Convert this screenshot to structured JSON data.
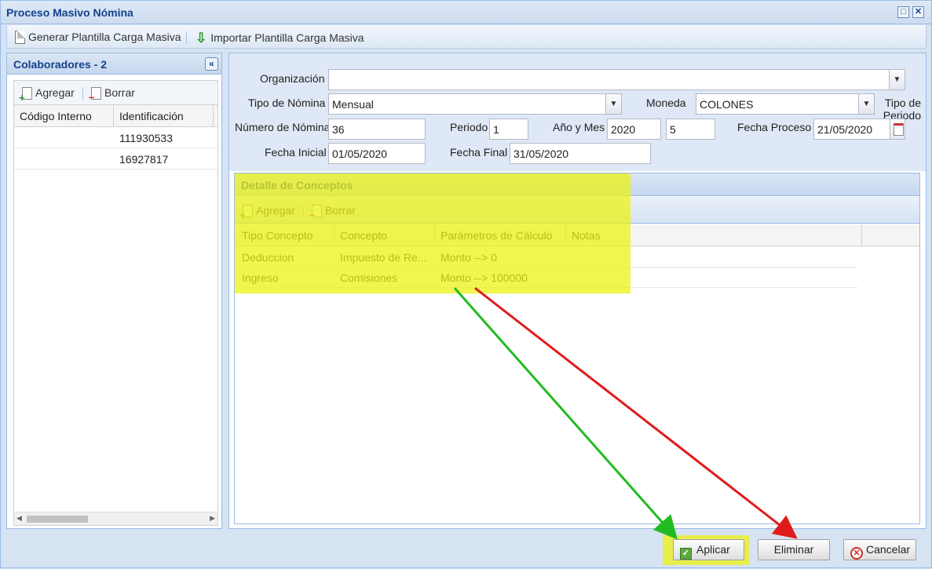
{
  "window": {
    "title": "Proceso Masivo Nómina",
    "maximize_glyph": "□",
    "close_glyph": "✕"
  },
  "toolbar": {
    "generate_label": "Generar Plantilla Carga Masiva",
    "import_label": "Importar Plantilla Carga Masiva"
  },
  "collaborators": {
    "title": "Colaboradores - 2",
    "collapse_glyph": "«",
    "add_label": "Agregar",
    "delete_label": "Borrar",
    "columns": [
      "Código Interno",
      "Identificación"
    ],
    "rows": [
      {
        "code": "",
        "id": "111930533"
      },
      {
        "code": "",
        "id": "16927817"
      }
    ]
  },
  "form": {
    "organizacion_label": "Organización",
    "organizacion_value": "",
    "tipo_nomina_label": "Tipo de Nómina",
    "tipo_nomina_value": "Mensual",
    "moneda_label": "Moneda",
    "moneda_value": "COLONES",
    "tipo_periodo_label": "Tipo de Periodo",
    "numero_nomina_label": "Número de Nómina",
    "numero_nomina_value": "36",
    "periodo_label": "Periodo",
    "periodo_value": "1",
    "anio_mes_label": "Año y Mes",
    "anio_value": "2020",
    "mes_value": "5",
    "fecha_proceso_label": "Fecha Proceso",
    "fecha_proceso_value": "21/05/2020",
    "fecha_inicial_label": "Fecha Inicial",
    "fecha_inicial_value": "01/05/2020",
    "fecha_final_label": "Fecha Final",
    "fecha_final_value": "31/05/2020"
  },
  "details": {
    "title": "Detalle de Conceptos",
    "add_label": "Agregar",
    "delete_label": "Borrar",
    "columns": [
      "Tipo Concepto",
      "Concepto",
      "Parámetros de Cálculo",
      "Notas"
    ],
    "rows": [
      {
        "tipo": "Deduccion",
        "concepto": "Impuesto de Re...",
        "parametros": "Monto --> 0",
        "notas": ""
      },
      {
        "tipo": "Ingreso",
        "concepto": "Comisiones",
        "parametros": "Monto --> 100000",
        "notas": ""
      }
    ]
  },
  "footer": {
    "apply_label": "Aplicar",
    "delete_label": "Eliminar",
    "cancel_label": "Cancelar"
  },
  "colors": {
    "highlight": "#ecf214",
    "arrow_green": "#22bb22",
    "arrow_red": "#e11b1b",
    "header_text": "#15428b"
  }
}
